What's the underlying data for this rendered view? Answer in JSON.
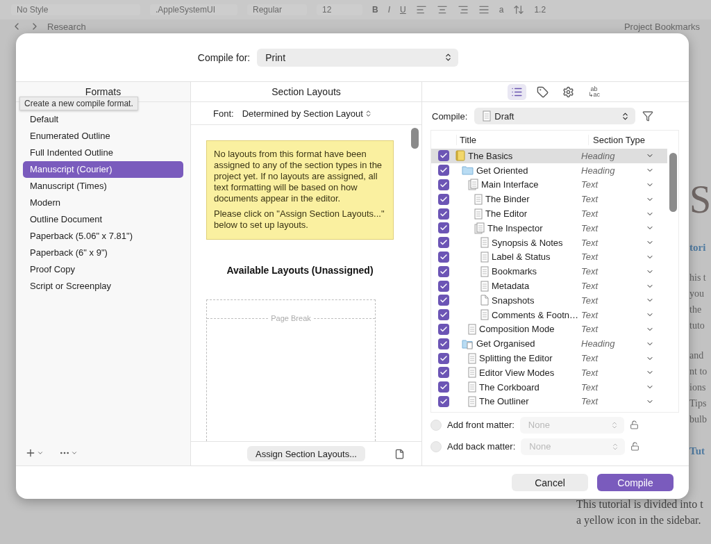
{
  "background_window": {
    "toolbar": {
      "style": "No Style",
      "font": ".AppleSystemUI",
      "weight": "Regular",
      "size": "12",
      "bold": "B",
      "italic": "I",
      "underline": "U",
      "text_color": "a",
      "line_spacing": "1.2"
    },
    "navigation": {
      "binder_title": "Research",
      "bookmarks_title": "Project Bookmarks"
    },
    "editor_paragraphs": [
      {
        "kind": "title",
        "lines": [
          "S"
        ]
      },
      {
        "kind": "heading",
        "lines": [
          "tori"
        ]
      },
      {
        "kind": "body",
        "lines": [
          "his t",
          "you",
          "the",
          "tuto"
        ]
      },
      {
        "kind": "body",
        "lines": [
          "and",
          "nt to",
          "ions",
          "Tips",
          "bulb"
        ]
      },
      {
        "kind": "heading",
        "lines": [
          "Tut"
        ]
      }
    ],
    "editor_bottom_lines": [
      "This tutorial is divided into t",
      "a yellow icon in the sidebar."
    ]
  },
  "dialog": {
    "compile_for": {
      "label": "Compile for:",
      "value": "Print"
    },
    "formats": {
      "title": "Formats",
      "tooltip": "Create a new compile format.",
      "items": [
        {
          "label": "Default",
          "selected": false
        },
        {
          "label": "Enumerated Outline",
          "selected": false
        },
        {
          "label": "Full Indented Outline",
          "selected": false
        },
        {
          "label": "Manuscript (Courier)",
          "selected": true
        },
        {
          "label": "Manuscript (Times)",
          "selected": false
        },
        {
          "label": "Modern",
          "selected": false
        },
        {
          "label": "Outline Document",
          "selected": false
        },
        {
          "label": "Paperback (5.06\" x 7.81\")",
          "selected": false
        },
        {
          "label": "Paperback (6\" x 9\")",
          "selected": false
        },
        {
          "label": "Proof Copy",
          "selected": false
        },
        {
          "label": "Script or Screenplay",
          "selected": false
        }
      ]
    },
    "section_layouts": {
      "title": "Section Layouts",
      "font_label": "Font:",
      "font_value": "Determined by Section Layout",
      "note": [
        "No layouts from this format have been assigned to any of the section types in the project yet. If no layouts are assigned, all text formatting will be based on how documents appear in the editor.",
        "Please click on \"Assign Section Layouts...\" below to set up layouts."
      ],
      "available_title": "Available Layouts (Unassigned)",
      "page_break": "Page Break",
      "assign_button": "Assign Section Layouts..."
    },
    "contents": {
      "tools": [
        {
          "kind": "list",
          "selected": true
        },
        {
          "kind": "tag",
          "selected": false
        },
        {
          "kind": "gear",
          "selected": false
        },
        {
          "kind": "replacements",
          "selected": false,
          "top": "ab",
          "bottom": "↳ac"
        }
      ],
      "compile_label": "Compile:",
      "compile_value": "Draft",
      "columns": [
        "Title",
        "Section Type"
      ],
      "rows": [
        {
          "title": "The Basics",
          "kind": "book",
          "section_type": "Heading",
          "checked": true,
          "selected": true,
          "children": [
            {
              "title": "Get Oriented",
              "kind": "folder",
              "section_type": "Heading",
              "checked": true,
              "selected": false,
              "children": [
                {
                  "title": "Main Interface",
                  "kind": "docs",
                  "section_type": "Text",
                  "checked": true,
                  "selected": false,
                  "children": [
                    {
                      "title": "The Binder",
                      "kind": "doc",
                      "section_type": "Text",
                      "checked": true,
                      "selected": false
                    },
                    {
                      "title": "The Editor",
                      "kind": "doc",
                      "section_type": "Text",
                      "checked": true,
                      "selected": false
                    },
                    {
                      "title": "The Inspector",
                      "kind": "docs",
                      "section_type": "Text",
                      "checked": true,
                      "selected": false,
                      "children": [
                        {
                          "title": "Synopsis & Notes",
                          "kind": "doc",
                          "section_type": "Text",
                          "checked": true,
                          "selected": false
                        },
                        {
                          "title": "Label & Status",
                          "kind": "doc",
                          "section_type": "Text",
                          "checked": true,
                          "selected": false
                        },
                        {
                          "title": "Bookmarks",
                          "kind": "doc",
                          "section_type": "Text",
                          "checked": true,
                          "selected": false
                        },
                        {
                          "title": "Metadata",
                          "kind": "doc",
                          "section_type": "Text",
                          "checked": true,
                          "selected": false
                        },
                        {
                          "title": "Snapshots",
                          "kind": "snapshot",
                          "section_type": "Text",
                          "checked": true,
                          "selected": false
                        },
                        {
                          "title": "Comments & Footn…",
                          "kind": "doc",
                          "section_type": "Text",
                          "checked": true,
                          "selected": false
                        }
                      ]
                    }
                  ]
                },
                {
                  "title": "Composition Mode",
                  "kind": "doc",
                  "section_type": "Text",
                  "checked": true,
                  "selected": false
                }
              ]
            },
            {
              "title": "Get Organised",
              "kind": "folder-docs",
              "section_type": "Heading",
              "checked": true,
              "selected": false,
              "children": [
                {
                  "title": "Splitting the Editor",
                  "kind": "doc",
                  "section_type": "Text",
                  "checked": true,
                  "selected": false
                },
                {
                  "title": "Editor View Modes",
                  "kind": "doc",
                  "section_type": "Text",
                  "checked": true,
                  "selected": false
                },
                {
                  "title": "The Corkboard",
                  "kind": "doc",
                  "section_type": "Text",
                  "checked": true,
                  "selected": false
                },
                {
                  "title": "The Outliner",
                  "kind": "doc",
                  "section_type": "Text",
                  "checked": true,
                  "selected": false
                }
              ]
            }
          ]
        }
      ],
      "matter": [
        {
          "label": "Add front matter:",
          "checked": false,
          "value": "None",
          "disabled": true
        },
        {
          "label": "Add back matter:",
          "checked": false,
          "value": "None",
          "disabled": true
        }
      ]
    },
    "buttons": [
      {
        "label": "Cancel",
        "kind": "secondary"
      },
      {
        "label": "Compile",
        "kind": "primary"
      }
    ]
  }
}
